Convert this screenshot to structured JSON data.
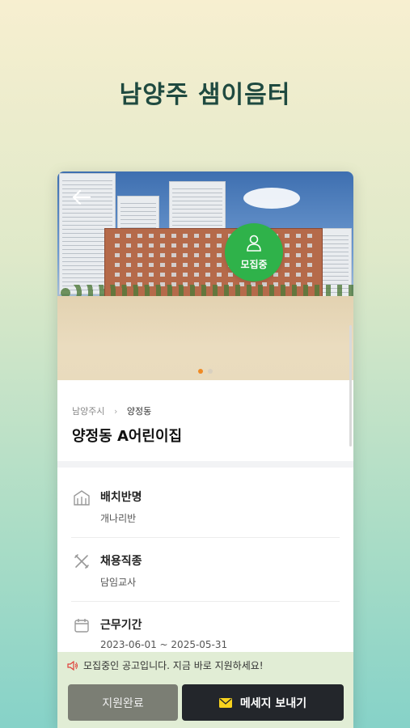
{
  "app": {
    "title": "남양주 샘이음터"
  },
  "place": {
    "breadcrumb": [
      "남양주시",
      "양정동"
    ],
    "name": "양정동 A어린이집",
    "status_badge": "모집중"
  },
  "details": [
    {
      "label": "배치반명",
      "value": "개나리반",
      "icon": "building-icon"
    },
    {
      "label": "채용직종",
      "value": "담임교사",
      "icon": "tools-icon"
    },
    {
      "label": "근무기간",
      "value": "2023-06-01 ~ 2025-05-31",
      "icon": "calendar-icon"
    }
  ],
  "carousel": {
    "total": 2,
    "active": 0
  },
  "bottom": {
    "notice": "모집중인 공고입니다. 지금 바로 지원하세요!",
    "apply_done_label": "지원완료",
    "message_label": "메세지 보내기"
  },
  "colors": {
    "status_green": "#2fb24a",
    "dot_active": "#f08a24",
    "title": "#1f4a40"
  }
}
